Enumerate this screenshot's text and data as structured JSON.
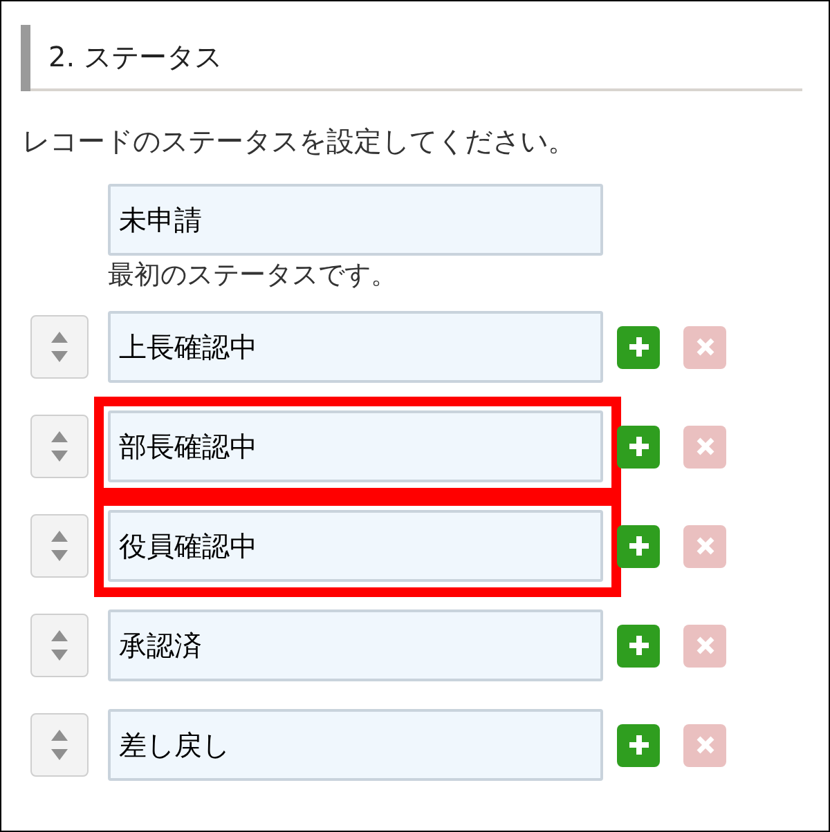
{
  "section": {
    "title": "2. ステータス",
    "description": "レコードのステータスを設定してください。"
  },
  "initial_status": {
    "value": "未申請",
    "note": "最初のステータスです。"
  },
  "statuses": [
    {
      "value": "上長確認中",
      "highlighted": false,
      "delete_disabled": true
    },
    {
      "value": "部長確認中",
      "highlighted": true,
      "delete_disabled": true
    },
    {
      "value": "役員確認中",
      "highlighted": true,
      "delete_disabled": true
    },
    {
      "value": "承認済",
      "highlighted": false,
      "delete_disabled": true
    },
    {
      "value": "差し戻し",
      "highlighted": false,
      "delete_disabled": true
    }
  ]
}
